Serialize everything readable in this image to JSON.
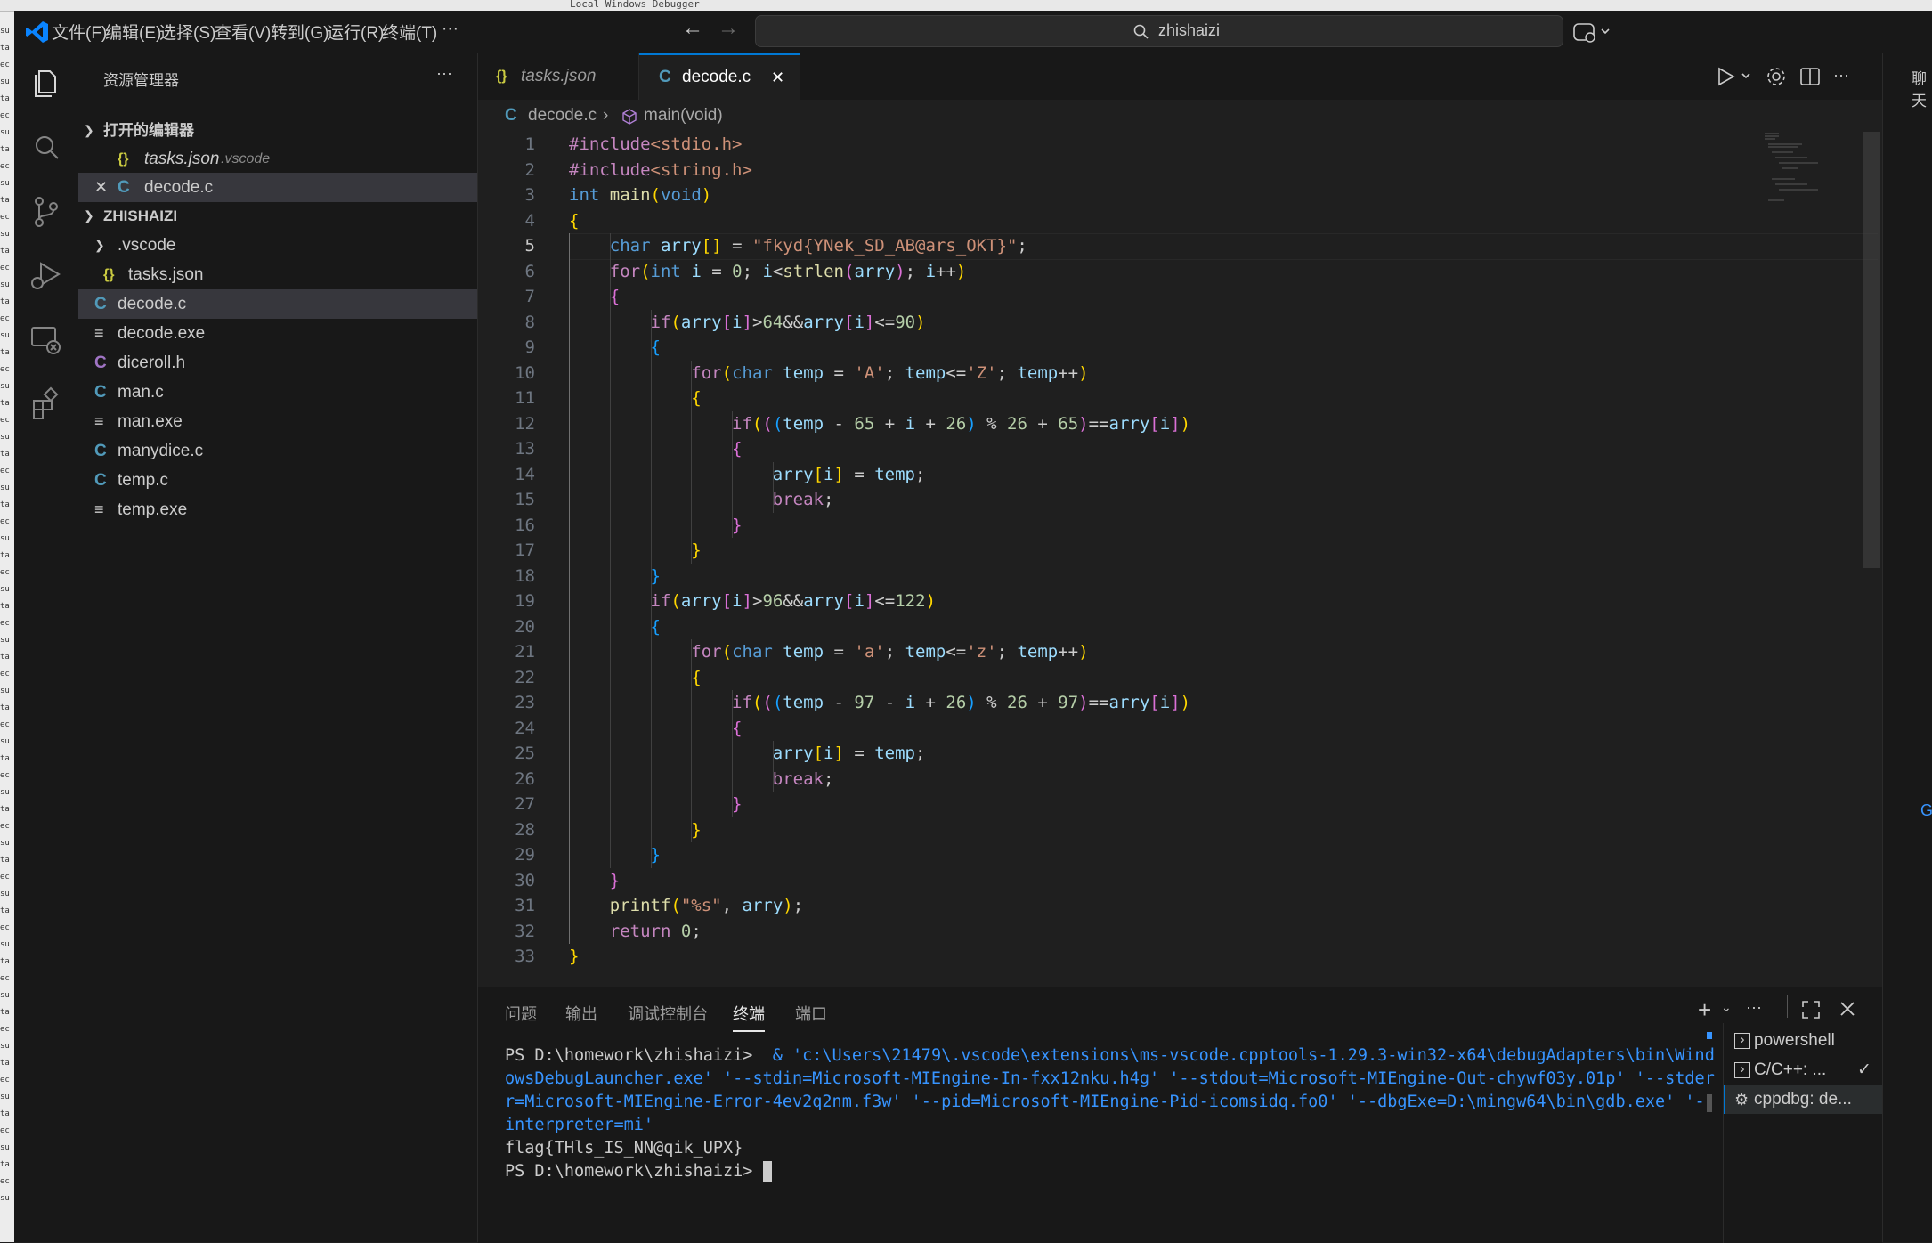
{
  "window": {
    "debug_config": "Local Windows Debugger"
  },
  "menu": [
    "文件(F)",
    "编辑(E)",
    "选择(S)",
    "查看(V)",
    "转到(G)",
    "运行(R)",
    "终端(T)",
    "···"
  ],
  "search": {
    "text": "zhishaizi"
  },
  "sidebar": {
    "title": "资源管理器",
    "more": "···",
    "open_editors_header": "打开的编辑器",
    "open_editors": [
      {
        "icon": "{}",
        "label": "tasks.json",
        "detail": ".vscode"
      },
      {
        "icon": "C",
        "label": "decode.c"
      }
    ],
    "workspace_header": "ZHISHAIZI",
    "folder": ".vscode",
    "files": [
      {
        "icon": "{}",
        "label": "tasks.json",
        "indent": 2
      },
      {
        "icon": "C",
        "label": "decode.c",
        "indent": 1
      },
      {
        "icon": "≡",
        "label": "decode.exe",
        "indent": 1
      },
      {
        "icon": "C",
        "label": "diceroll.h",
        "indent": 1
      },
      {
        "icon": "C",
        "label": "man.c",
        "indent": 1
      },
      {
        "icon": "≡",
        "label": "man.exe",
        "indent": 1
      },
      {
        "icon": "C",
        "label": "manydice.c",
        "indent": 1
      },
      {
        "icon": "C",
        "label": "temp.c",
        "indent": 1
      },
      {
        "icon": "≡",
        "label": "temp.exe",
        "indent": 1
      }
    ]
  },
  "tabs": [
    {
      "icon": "{}",
      "label": "tasks.json"
    },
    {
      "icon": "C",
      "label": "decode.c",
      "close": "✕"
    }
  ],
  "breadcrumb": {
    "file": "decode.c",
    "symbol": "main(void)"
  },
  "editor": {
    "current_line": 5,
    "lines": [
      "#include<stdio.h>",
      "#include<string.h>",
      "int main(void)",
      "{",
      "    char arry[] = \"fkyd{YNek_SD_AB@ars_OKT}\";",
      "    for(int i = 0; i<strlen(arry); i++)",
      "    {",
      "        if(arry[i]>64&&arry[i]<=90)",
      "        {",
      "            for(char temp = 'A'; temp<='Z'; temp++)",
      "            {",
      "                if(((temp - 65 + i + 26) % 26 + 65)==arry[i])",
      "                {",
      "                    arry[i] = temp;",
      "                    break;",
      "                }",
      "            }",
      "        }",
      "        if(arry[i]>96&&arry[i]<=122)",
      "        {",
      "            for(char temp = 'a'; temp<='z'; temp++)",
      "            {",
      "                if(((temp - 97 - i + 26) % 26 + 97)==arry[i])",
      "                {",
      "                    arry[i] = temp;",
      "                    break;",
      "                }",
      "            }",
      "        }",
      "    }",
      "    printf(\"%s\", arry);",
      "    return 0;",
      "}"
    ]
  },
  "panel": {
    "tabs": [
      "问题",
      "输出",
      "调试控制台",
      "终端",
      "端口"
    ],
    "active_tab": "终端",
    "terminal_lines": [
      {
        "prompt": "PS D:\\homework\\zhishaizi> ",
        "cmd": " & 'c:\\Users\\21479\\.vscode\\extensions\\ms-vscode.cpptools-1.29.3-win32-x64\\debugAdapters\\bin\\Wind"
      },
      {
        "prompt": "",
        "cmd": "owsDebugLauncher.exe' '--stdin=Microsoft-MIEngine-In-fxx12nku.h4g' '--stdout=Microsoft-MIEngine-Out-chywf03y.01p' '--stder"
      },
      {
        "prompt": "",
        "cmd": "r=Microsoft-MIEngine-Error-4ev2q2nm.f3w' '--pid=Microsoft-MIEngine-Pid-icomsidq.fo0' '--dbgExe=D:\\mingw64\\bin\\gdb.exe' '--"
      },
      {
        "prompt": "",
        "cmd": "interpreter=mi'"
      },
      {
        "prompt": "flag{THls_IS_NN@qik_UPX}",
        "cmd": ""
      },
      {
        "prompt": "PS D:\\homework\\zhishaizi> ",
        "cmd": ""
      }
    ],
    "terminals": [
      {
        "label": "powershell"
      },
      {
        "label": "C/C++: ...",
        "check": "✓"
      },
      {
        "label": "cppdbg: de..."
      }
    ]
  },
  "rightbar": {
    "label": "聊天",
    "g": "G"
  },
  "colors": {
    "accent": "#0078d4",
    "c_icon": "#519aba",
    "json_icon": "#cbcb41"
  }
}
